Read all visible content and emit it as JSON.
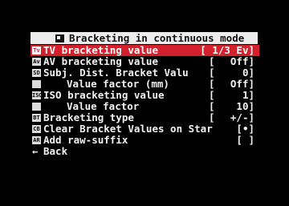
{
  "title": "Bracketing in continuous mode",
  "items": [
    {
      "icon": "Tv",
      "label": "TV bracketing value",
      "bracket": "",
      "value": "[ 1/3 Ev]",
      "selected": true
    },
    {
      "icon": "Av",
      "label": "AV bracketing value",
      "bracket": "[",
      "value": "Off]",
      "selected": false
    },
    {
      "icon": "SD",
      "label": "Subj. Dist. Bracket Valu",
      "bracket": "[",
      "value": "0]",
      "selected": false
    },
    {
      "icon": "",
      "label": "Value factor (mm)",
      "bracket": "[",
      "value": "Off]",
      "selected": false
    },
    {
      "icon": "ISO",
      "label": "ISO bracketing value",
      "bracket": "[",
      "value": "1]",
      "selected": false
    },
    {
      "icon": "",
      "label": "Value factor",
      "bracket": "[",
      "value": "10]",
      "selected": false
    },
    {
      "icon": "BT",
      "label": "Bracketing type",
      "bracket": "[",
      "value": "+/-]",
      "selected": false
    },
    {
      "icon": "CB",
      "label": "Clear Bracket Values on Star",
      "bracket": "",
      "value": "[•]",
      "selected": false
    },
    {
      "icon": "AR",
      "label": "Add raw-suffix",
      "bracket": "",
      "value": "[ ]",
      "selected": false
    }
  ],
  "back_label": "Back"
}
